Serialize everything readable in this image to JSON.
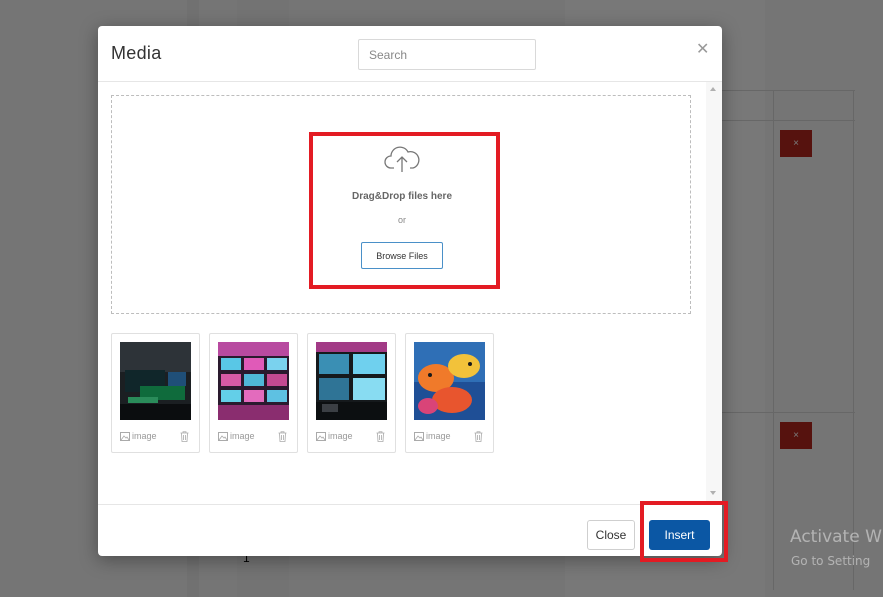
{
  "modal": {
    "title": "Media",
    "search_placeholder": "Search",
    "close_icon": "close-icon"
  },
  "dropzone": {
    "icon": "cloud-upload-icon",
    "text": "Drag&Drop files here",
    "or_text": "or",
    "browse_label": "Browse Files"
  },
  "thumbnails": [
    {
      "label": "image",
      "icon": "image-icon",
      "action_icon": "trash-icon"
    },
    {
      "label": "image",
      "icon": "image-icon",
      "action_icon": "trash-icon"
    },
    {
      "label": "image",
      "icon": "image-icon",
      "action_icon": "trash-icon"
    },
    {
      "label": "image",
      "icon": "image-icon",
      "action_icon": "trash-icon"
    }
  ],
  "footer": {
    "close_label": "Close",
    "insert_label": "Insert"
  },
  "background": {
    "row_number": "1",
    "delete_symbol": "×",
    "activate_title": "Activate W",
    "activate_sub": "Go to Setting"
  },
  "colors": {
    "primary": "#0b57a4",
    "danger": "#b3261e",
    "highlight": "#e31b23"
  }
}
